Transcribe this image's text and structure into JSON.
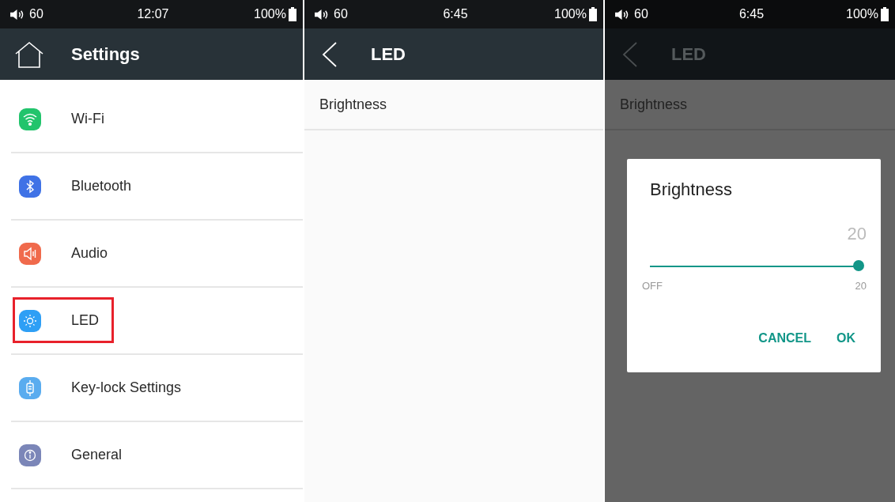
{
  "panels": [
    {
      "dimmed": false,
      "status_bar": {
        "volume": "60",
        "time": "12:07",
        "battery": "100%"
      },
      "header": {
        "kind": "home",
        "title": "Settings"
      },
      "items": [
        {
          "kind": "wifi",
          "label": "Wi-Fi",
          "color": "#22c46c",
          "highlighted": false
        },
        {
          "kind": "bluetooth",
          "label": "Bluetooth",
          "color": "#3f72e6",
          "highlighted": false
        },
        {
          "kind": "audio",
          "label": "Audio",
          "color": "#f06a4c",
          "highlighted": false
        },
        {
          "kind": "led",
          "label": "LED",
          "color": "#2e9ff5",
          "highlighted": true
        },
        {
          "kind": "keylock",
          "label": "Key-lock Settings",
          "color": "#5aacef",
          "highlighted": false
        },
        {
          "kind": "general",
          "label": "General",
          "color": "#7b86b8",
          "highlighted": false
        }
      ]
    },
    {
      "dimmed": false,
      "status_bar": {
        "volume": "60",
        "time": "6:45",
        "battery": "100%"
      },
      "header": {
        "kind": "back",
        "title": "LED"
      },
      "items": [
        {
          "kind": "text",
          "label": "Brightness",
          "highlighted": false
        }
      ]
    },
    {
      "dimmed": true,
      "status_bar": {
        "volume": "60",
        "time": "6:45",
        "battery": "100%"
      },
      "header": {
        "kind": "back",
        "title": "LED"
      },
      "items": [
        {
          "kind": "text",
          "label": "Brightness",
          "highlighted": false
        }
      ],
      "dialog": {
        "title": "Brightness",
        "value": "20",
        "level": 1.0,
        "min_label": "OFF",
        "max_label": "20",
        "buttons": [
          "CANCEL",
          "OK"
        ]
      }
    }
  ]
}
